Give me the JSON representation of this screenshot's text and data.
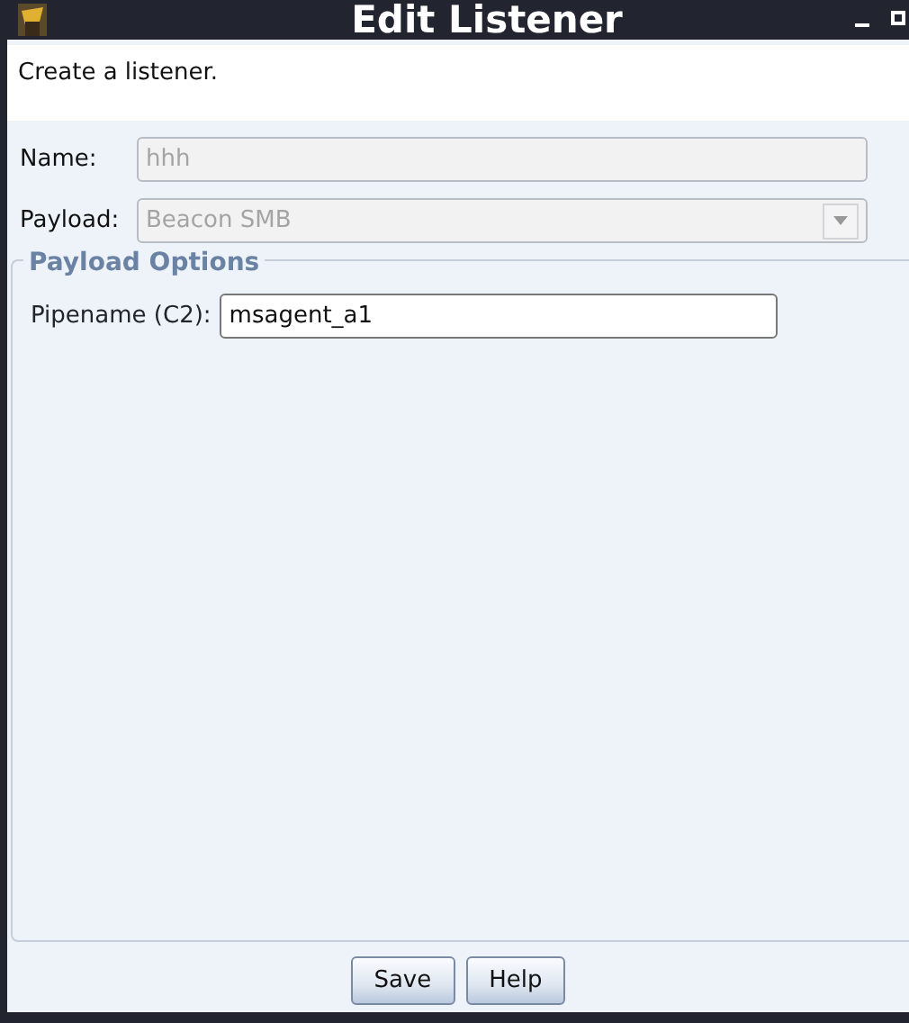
{
  "window": {
    "title": "Edit Listener"
  },
  "description": "Create a listener.",
  "fields": [
    {
      "kind": "text",
      "label": "Name:",
      "value": "hhh",
      "disabled": true
    },
    {
      "kind": "select",
      "label": "Payload:",
      "value": "Beacon SMB",
      "disabled": true
    }
  ],
  "group": {
    "title": "Payload Options",
    "fields": [
      {
        "kind": "text",
        "label": "Pipename (C2):",
        "value": "msagent_a1",
        "disabled": false
      }
    ]
  },
  "buttons": [
    "Save",
    "Help"
  ]
}
